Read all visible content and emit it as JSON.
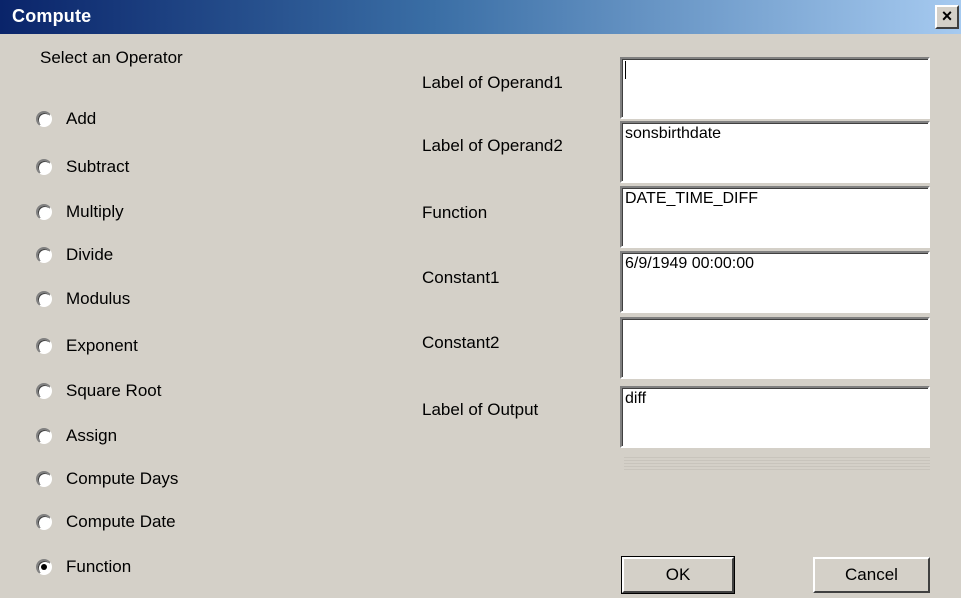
{
  "window": {
    "title": "Compute",
    "close_glyph": "×"
  },
  "operators": {
    "heading": "Select an Operator",
    "items": [
      {
        "label": "Add",
        "checked": false
      },
      {
        "label": "Subtract",
        "checked": false
      },
      {
        "label": "Multiply",
        "checked": false
      },
      {
        "label": "Divide",
        "checked": false
      },
      {
        "label": "Modulus",
        "checked": false
      },
      {
        "label": "Exponent",
        "checked": false
      },
      {
        "label": "Square Root",
        "checked": false
      },
      {
        "label": "Assign",
        "checked": false
      },
      {
        "label": "Compute Days",
        "checked": false
      },
      {
        "label": "Compute Date",
        "checked": false
      },
      {
        "label": "Function",
        "checked": true
      }
    ]
  },
  "fields": [
    {
      "label": "Label of Operand1",
      "value": ""
    },
    {
      "label": "Label of Operand2",
      "value": "sonsbirthdate"
    },
    {
      "label": "Function",
      "value": "DATE_TIME_DIFF"
    },
    {
      "label": "Constant1",
      "value": "6/9/1949 00:00:00"
    },
    {
      "label": "Constant2",
      "value": ""
    },
    {
      "label": "Label of Output",
      "value": "diff"
    }
  ],
  "buttons": {
    "ok": "OK",
    "cancel": "Cancel"
  },
  "colors": {
    "titlebar_start": "#0a246a",
    "titlebar_end": "#a6caf0",
    "face": "#d4d0c8"
  }
}
